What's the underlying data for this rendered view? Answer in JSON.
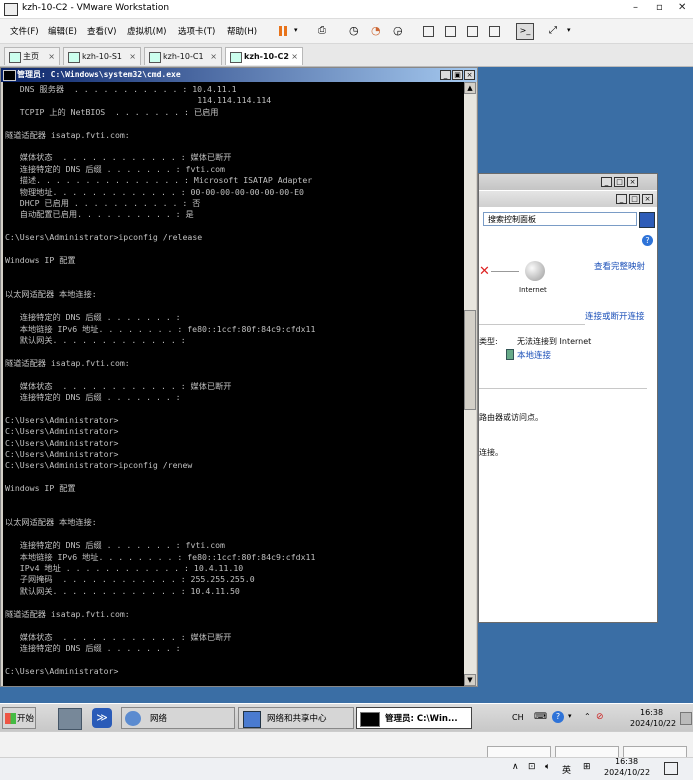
{
  "vmware": {
    "title": "kzh-10-C2 - VMware Workstation",
    "menu": [
      "文件(F)",
      "编辑(E)",
      "查看(V)",
      "虚拟机(M)",
      "选项卡(T)",
      "帮助(H)"
    ],
    "tabs": [
      "主页",
      "kzh-10-S1",
      "kzh-10-C1",
      "kzh-10-C2"
    ]
  },
  "cmd": {
    "title": "管理员: C:\\Windows\\system32\\cmd.exe",
    "lines": [
      "   DNS 服务器  . . . . . . . . . . . : 10.4.11.1",
      "                                       114.114.114.114",
      "   TCPIP 上的 NetBIOS  . . . . . . . : 已启用",
      "",
      "隧道适配器 isatap.fvti.com:",
      "",
      "   媒体状态  . . . . . . . . . . . . : 媒体已断开",
      "   连接特定的 DNS 后缀 . . . . . . . : fvti.com",
      "   描述. . . . . . . . . . . . . . . : Microsoft ISATAP Adapter",
      "   物理地址. . . . . . . . . . . . . : 00-00-00-00-00-00-00-E0",
      "   DHCP 已启用 . . . . . . . . . . . : 否",
      "   自动配置已启用. . . . . . . . . . : 是",
      "",
      "C:\\Users\\Administrator>ipconfig /release",
      "",
      "Windows IP 配置",
      "",
      "",
      "以太网适配器 本地连接:",
      "",
      "   连接特定的 DNS 后缀 . . . . . . . :",
      "   本地链接 IPv6 地址. . . . . . . . : fe80::1ccf:80f:84c9:cfdx11",
      "   默认网关. . . . . . . . . . . . . :",
      "",
      "隧道适配器 isatap.fvti.com:",
      "",
      "   媒体状态  . . . . . . . . . . . . : 媒体已断开",
      "   连接特定的 DNS 后缀 . . . . . . . :",
      "",
      "C:\\Users\\Administrator>",
      "C:\\Users\\Administrator>",
      "C:\\Users\\Administrator>",
      "C:\\Users\\Administrator>",
      "C:\\Users\\Administrator>ipconfig /renew",
      "",
      "Windows IP 配置",
      "",
      "",
      "以太网适配器 本地连接:",
      "",
      "   连接特定的 DNS 后缀 . . . . . . . : fvti.com",
      "   本地链接 IPv6 地址. . . . . . . . : fe80::1ccf:80f:84c9:cfdx11",
      "   IPv4 地址 . . . . . . . . . . . . : 10.4.11.10",
      "   子网掩码  . . . . . . . . . . . . : 255.255.255.0",
      "   默认网关. . . . . . . . . . . . . : 10.4.11.50",
      "",
      "隧道适配器 isatap.fvti.com:",
      "",
      "   媒体状态  . . . . . . . . . . . . : 媒体已断开",
      "   连接特定的 DNS 后缀 . . . . . . . :",
      "",
      "C:\\Users\\Administrator>"
    ]
  },
  "control_panel": {
    "search_placeholder": "搜索控制面板",
    "view_full_map": "查看完整映射",
    "internet_label": "Internet",
    "connect_disconnect": "连接或断开连接",
    "type_label": "类型:",
    "type_value": "无法连接到 Internet",
    "local_connection": "本地连接",
    "router_text": "路由器或访问点。",
    "connect_text": "连接。"
  },
  "guest_taskbar": {
    "start": "开始",
    "items": [
      "网络",
      "网络和共享中心",
      "管理员: C:\\Win..."
    ],
    "ime": "CH",
    "time": "16:38",
    "date": "2024/10/22"
  },
  "host_taskbar": {
    "ime": "英",
    "time": "16:38",
    "date": "2024/10/22"
  }
}
